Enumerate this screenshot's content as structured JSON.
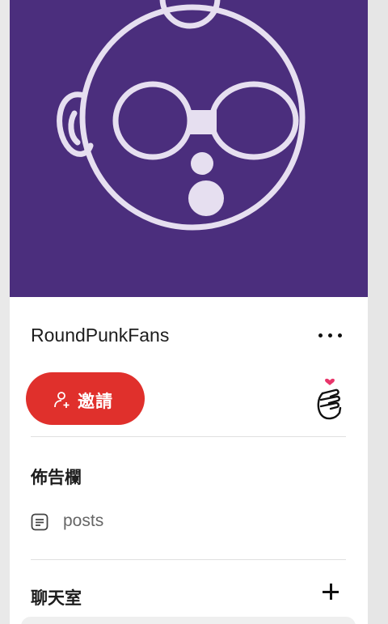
{
  "group": {
    "name": "RoundPunkFans",
    "more_icon": "more-horizontal-icon",
    "avatar_icon": "round-punk-avatar",
    "avatar_bg": "#4b2e7d"
  },
  "actions": {
    "invite_label": "邀請",
    "invite_icon": "add-user-icon",
    "invite_color": "#e0302c",
    "reaction_icon": "finger-heart-icon"
  },
  "bulletin": {
    "title": "佈告欄",
    "items": [
      {
        "icon": "posts-icon",
        "label": "posts"
      }
    ]
  },
  "chat": {
    "title": "聊天室",
    "add_icon": "plus-icon"
  }
}
